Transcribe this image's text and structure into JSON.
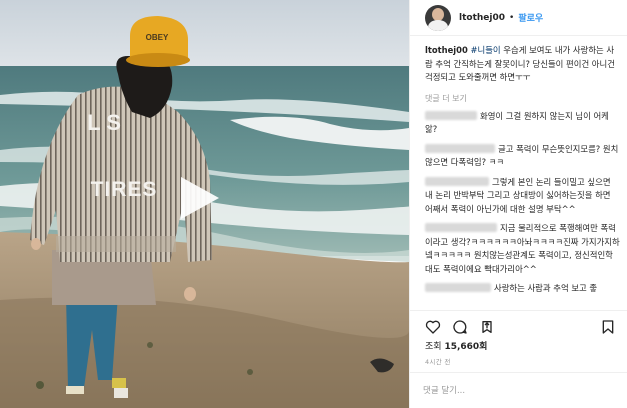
{
  "header": {
    "username": "ltothej00",
    "separator": "•",
    "follow_label": "팔로우"
  },
  "caption": {
    "username": "ltothej00",
    "hashtag": "#니들이",
    "text": " 우습게 보여도 내가 사랑하는 사람 추억 간직하는게 잘못이니? 당신들이 편이건 아니건 걱정되고 도와줄꺼면 하면ㅜㅜ"
  },
  "more_label": "댓글 더 보기",
  "comments": [
    {
      "visible_text": "화영이 그걸 원하지 않는지 님이 어케앎?"
    },
    {
      "visible_text": "글고 폭력이 무슨뜻인지모름? 원치않으면 다폭력임? ㅋㅋ"
    },
    {
      "visible_text": "그렇게 본인 논리 들이밀고 싶으면 내 논리 반박부탁 그리고 상대방이 싫어하는짓을 하면 어째서 폭력이 아닌가에 대한 설명 부탁^^"
    },
    {
      "visible_text": "지금 물리적으로 폭행해여만 폭력이라고 생각?ㅋㅋㅋㅋㅋㅋ아놔ㅋㅋㅋㅋ진짜 가지가지하넼ㅋㅋㅋㅋㅋ 원치않는성관계도 폭력이고, 정신적인학대도 폭력이에요 빡대가리아^^"
    },
    {
      "visible_text": "사랑하는 사람과 추억 보고 좋"
    }
  ],
  "icons": {
    "like": "heart-icon",
    "comment": "comment-icon",
    "share": "share-icon",
    "save": "bookmark-icon",
    "play": "play-icon"
  },
  "views": {
    "label": "조회",
    "count": "15,660회"
  },
  "timestamp": "4시간 전",
  "add_comment": {
    "placeholder": "댓글 달기..."
  },
  "media": {
    "jacket_text": [
      "L S",
      "TIRES"
    ],
    "cap_text": "OBEY"
  },
  "colors": {
    "link_blue": "#3897f0",
    "hashtag": "#003569",
    "text": "#262626",
    "muted": "#999999"
  }
}
